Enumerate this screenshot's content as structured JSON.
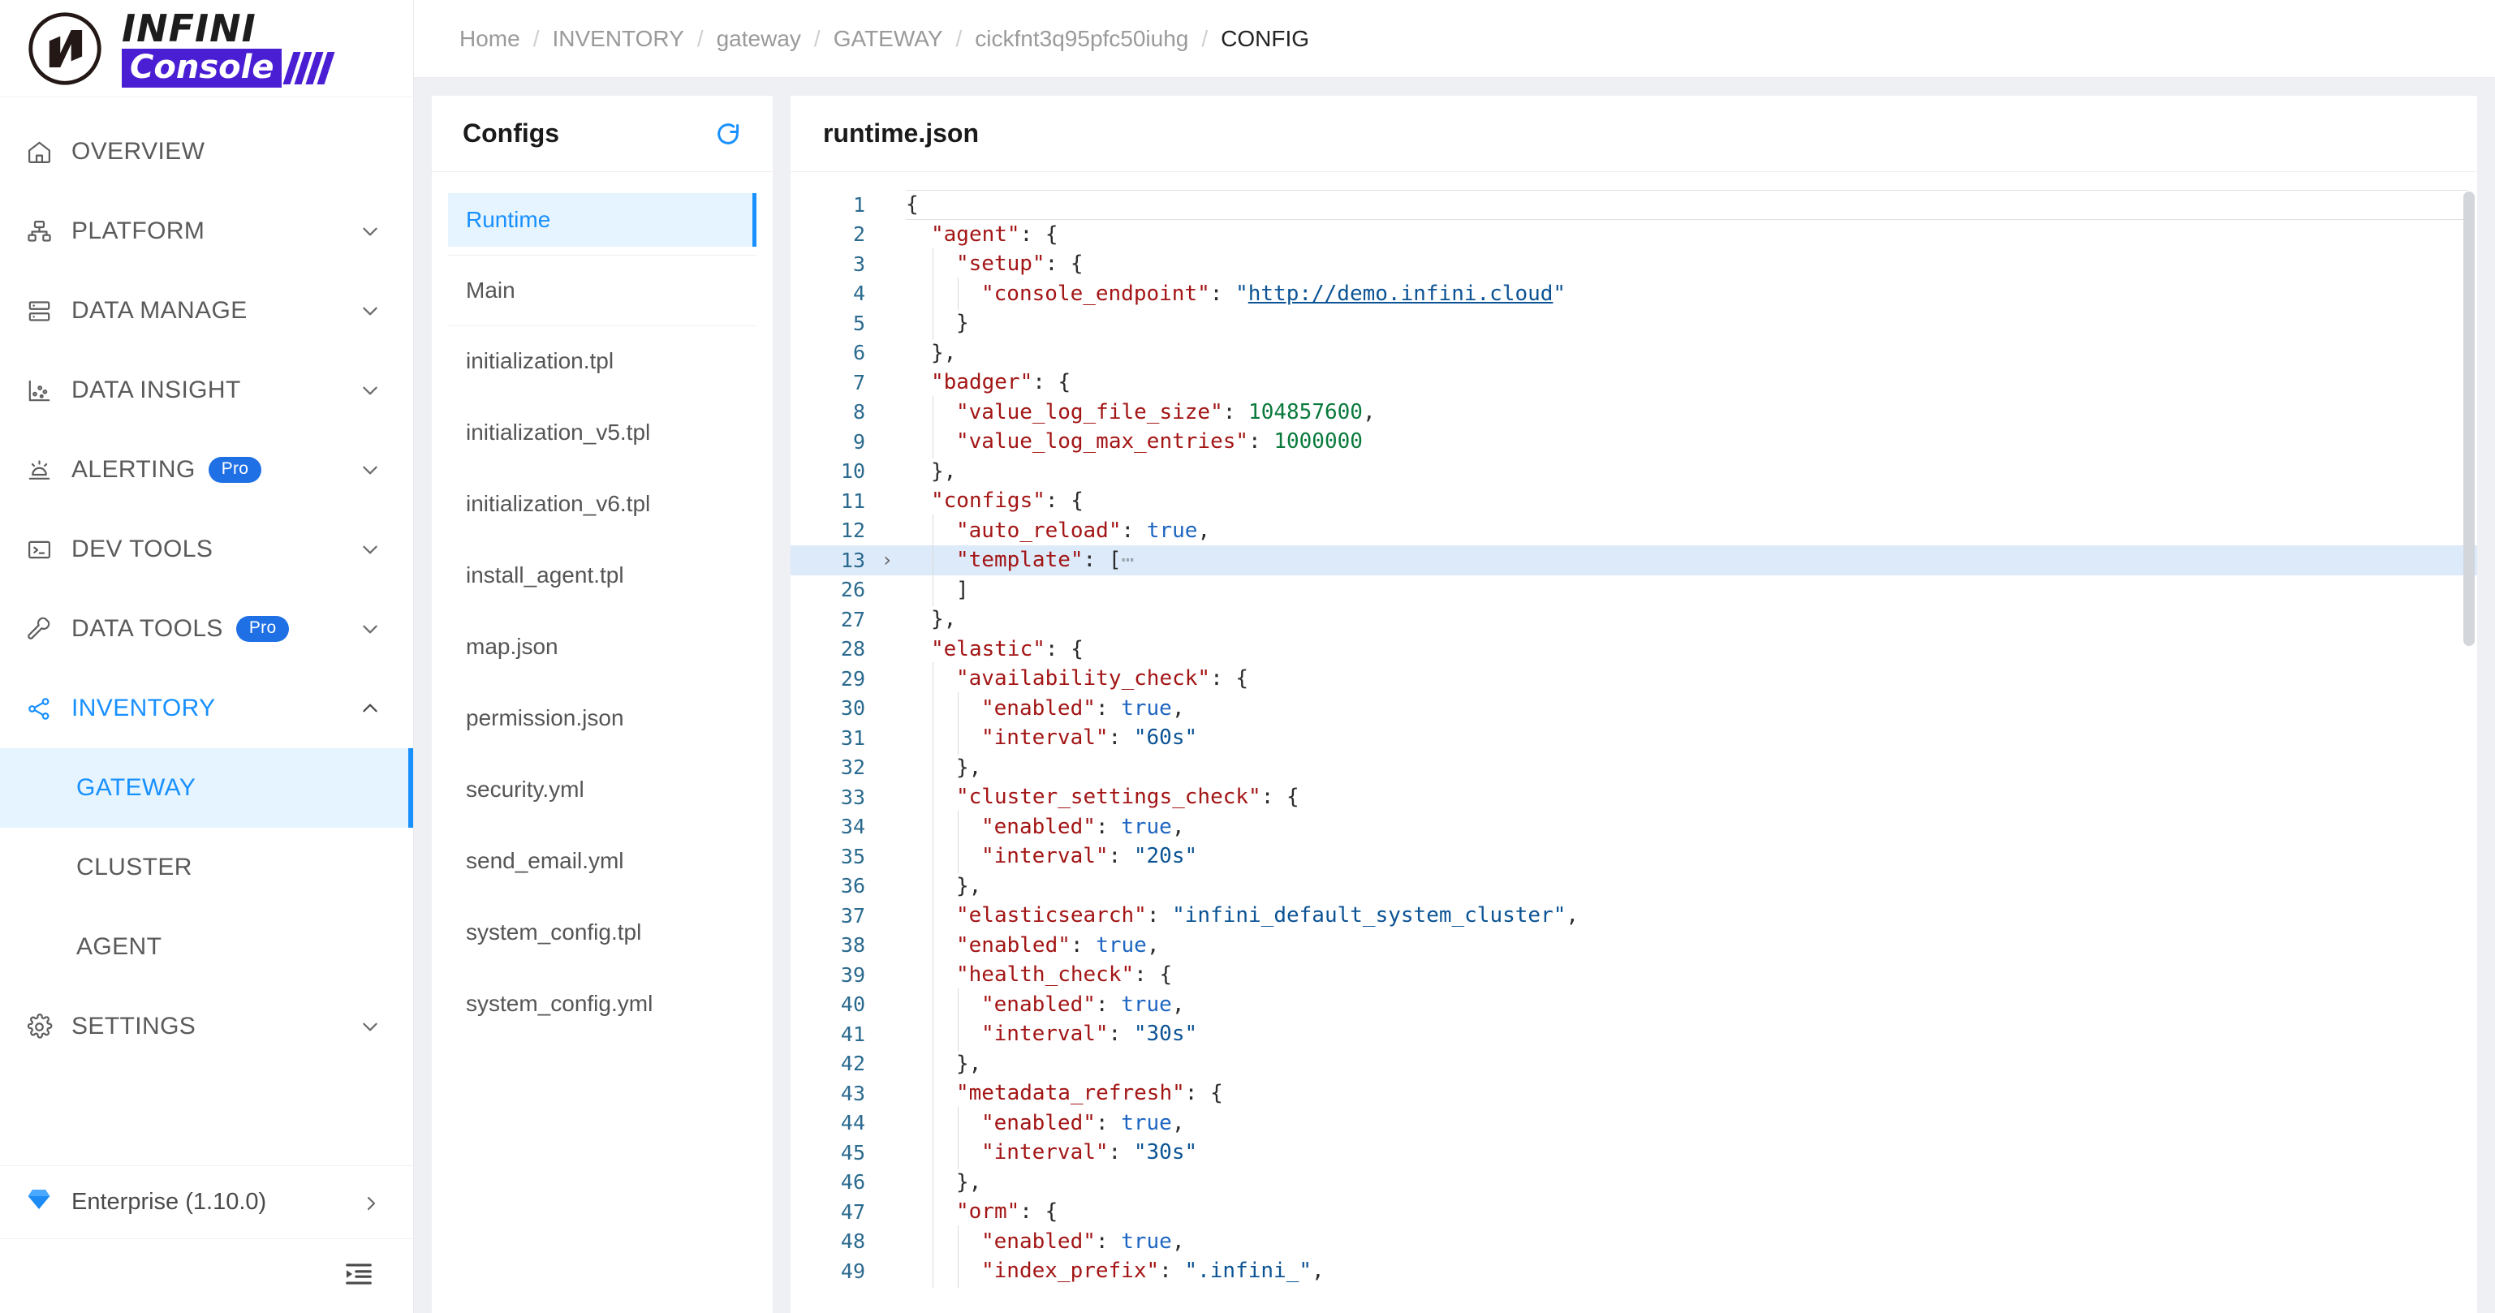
{
  "brand": {
    "name_top": "INFINI",
    "name_bottom": "Console",
    "accent_purple": "#4a1fd4"
  },
  "sidebar": {
    "items": [
      {
        "label": "OVERVIEW",
        "icon": "home-icon",
        "expandable": false,
        "badge": null,
        "active": false
      },
      {
        "label": "PLATFORM",
        "icon": "sitemap-icon",
        "expandable": true,
        "badge": null,
        "active": false
      },
      {
        "label": "DATA MANAGE",
        "icon": "database-icon",
        "expandable": true,
        "badge": null,
        "active": false
      },
      {
        "label": "DATA INSIGHT",
        "icon": "scatter-icon",
        "expandable": true,
        "badge": null,
        "active": false
      },
      {
        "label": "ALERTING",
        "icon": "alarm-icon",
        "expandable": true,
        "badge": "Pro",
        "active": false
      },
      {
        "label": "DEV TOOLS",
        "icon": "terminal-icon",
        "expandable": true,
        "badge": null,
        "active": false
      },
      {
        "label": "DATA TOOLS",
        "icon": "wrench-icon",
        "expandable": true,
        "badge": "Pro",
        "active": false
      },
      {
        "label": "INVENTORY",
        "icon": "share-icon",
        "expandable": true,
        "badge": null,
        "active": true
      }
    ],
    "inventory_children": [
      {
        "label": "GATEWAY",
        "selected": true
      },
      {
        "label": "CLUSTER",
        "selected": false
      },
      {
        "label": "AGENT",
        "selected": false
      }
    ],
    "settings": {
      "label": "SETTINGS",
      "icon": "gear-icon",
      "expandable": true
    },
    "footer": {
      "label": "Enterprise (1.10.0)",
      "icon": "diamond-icon"
    },
    "collapse": {
      "icon": "menu-fold-icon"
    },
    "accent_blue": "#1890ff",
    "badge_blue": "#1f6fe5"
  },
  "breadcrumb": {
    "separator": "/",
    "items": [
      {
        "label": "Home",
        "current": false
      },
      {
        "label": "INVENTORY",
        "current": false
      },
      {
        "label": "gateway",
        "current": false
      },
      {
        "label": "GATEWAY",
        "current": false
      },
      {
        "label": "cickfnt3q95pfc50iuhg",
        "current": false
      },
      {
        "label": "CONFIG",
        "current": true
      }
    ]
  },
  "configs_panel": {
    "title": "Configs",
    "refresh_icon": "refresh-icon",
    "groups": [
      {
        "items": [
          {
            "label": "Runtime",
            "selected": true
          }
        ]
      },
      {
        "items": [
          {
            "label": "Main",
            "selected": false
          }
        ]
      },
      {
        "items": [
          {
            "label": "initialization.tpl",
            "selected": false
          },
          {
            "label": "initialization_v5.tpl",
            "selected": false
          },
          {
            "label": "initialization_v6.tpl",
            "selected": false
          },
          {
            "label": "install_agent.tpl",
            "selected": false
          },
          {
            "label": "map.json",
            "selected": false
          },
          {
            "label": "permission.json",
            "selected": false
          },
          {
            "label": "security.yml",
            "selected": false
          },
          {
            "label": "send_email.yml",
            "selected": false
          },
          {
            "label": "system_config.tpl",
            "selected": false
          },
          {
            "label": "system_config.yml",
            "selected": false
          }
        ]
      }
    ]
  },
  "editor": {
    "filename": "runtime.json",
    "language": "json",
    "active_line": 13,
    "folded_line": 13,
    "lines": [
      {
        "no": "1",
        "indent": 0,
        "fold": "",
        "tokens": [
          {
            "t": "{",
            "c": "p"
          }
        ]
      },
      {
        "no": "2",
        "indent": 1,
        "fold": "",
        "tokens": [
          {
            "t": "\"agent\"",
            "c": "k"
          },
          {
            "t": ": {",
            "c": "p"
          }
        ]
      },
      {
        "no": "3",
        "indent": 2,
        "fold": "",
        "tokens": [
          {
            "t": "\"setup\"",
            "c": "k"
          },
          {
            "t": ": {",
            "c": "p"
          }
        ]
      },
      {
        "no": "4",
        "indent": 3,
        "fold": "",
        "tokens": [
          {
            "t": "\"console_endpoint\"",
            "c": "k"
          },
          {
            "t": ": ",
            "c": "p"
          },
          {
            "t": "\"",
            "c": "s"
          },
          {
            "t": "http://demo.infini.cloud",
            "c": "url"
          },
          {
            "t": "\"",
            "c": "s"
          }
        ]
      },
      {
        "no": "5",
        "indent": 2,
        "fold": "",
        "tokens": [
          {
            "t": "}",
            "c": "p"
          }
        ]
      },
      {
        "no": "6",
        "indent": 1,
        "fold": "",
        "tokens": [
          {
            "t": "},",
            "c": "p"
          }
        ]
      },
      {
        "no": "7",
        "indent": 1,
        "fold": "",
        "tokens": [
          {
            "t": "\"badger\"",
            "c": "k"
          },
          {
            "t": ": {",
            "c": "p"
          }
        ]
      },
      {
        "no": "8",
        "indent": 2,
        "fold": "",
        "tokens": [
          {
            "t": "\"value_log_file_size\"",
            "c": "k"
          },
          {
            "t": ": ",
            "c": "p"
          },
          {
            "t": "104857600",
            "c": "n"
          },
          {
            "t": ",",
            "c": "p"
          }
        ]
      },
      {
        "no": "9",
        "indent": 2,
        "fold": "",
        "tokens": [
          {
            "t": "\"value_log_max_entries\"",
            "c": "k"
          },
          {
            "t": ": ",
            "c": "p"
          },
          {
            "t": "1000000",
            "c": "n"
          }
        ]
      },
      {
        "no": "10",
        "indent": 1,
        "fold": "",
        "tokens": [
          {
            "t": "},",
            "c": "p"
          }
        ]
      },
      {
        "no": "11",
        "indent": 1,
        "fold": "",
        "tokens": [
          {
            "t": "\"configs\"",
            "c": "k"
          },
          {
            "t": ": {",
            "c": "p"
          }
        ]
      },
      {
        "no": "12",
        "indent": 2,
        "fold": "",
        "tokens": [
          {
            "t": "\"auto_reload\"",
            "c": "k"
          },
          {
            "t": ": ",
            "c": "p"
          },
          {
            "t": "true",
            "c": "b"
          },
          {
            "t": ",",
            "c": "p"
          }
        ]
      },
      {
        "no": "13",
        "indent": 2,
        "fold": "›",
        "active": true,
        "tokens": [
          {
            "t": "\"template\"",
            "c": "k"
          },
          {
            "t": ": [",
            "c": "p"
          },
          {
            "t": "⋯",
            "c": "ell"
          }
        ]
      },
      {
        "no": "26",
        "indent": 2,
        "fold": "",
        "tokens": [
          {
            "t": "]",
            "c": "p"
          }
        ]
      },
      {
        "no": "27",
        "indent": 1,
        "fold": "",
        "tokens": [
          {
            "t": "},",
            "c": "p"
          }
        ]
      },
      {
        "no": "28",
        "indent": 1,
        "fold": "",
        "tokens": [
          {
            "t": "\"elastic\"",
            "c": "k"
          },
          {
            "t": ": {",
            "c": "p"
          }
        ]
      },
      {
        "no": "29",
        "indent": 2,
        "fold": "",
        "tokens": [
          {
            "t": "\"availability_check\"",
            "c": "k"
          },
          {
            "t": ": {",
            "c": "p"
          }
        ]
      },
      {
        "no": "30",
        "indent": 3,
        "fold": "",
        "tokens": [
          {
            "t": "\"enabled\"",
            "c": "k"
          },
          {
            "t": ": ",
            "c": "p"
          },
          {
            "t": "true",
            "c": "b"
          },
          {
            "t": ",",
            "c": "p"
          }
        ]
      },
      {
        "no": "31",
        "indent": 3,
        "fold": "",
        "tokens": [
          {
            "t": "\"interval\"",
            "c": "k"
          },
          {
            "t": ": ",
            "c": "p"
          },
          {
            "t": "\"60s\"",
            "c": "s"
          }
        ]
      },
      {
        "no": "32",
        "indent": 2,
        "fold": "",
        "tokens": [
          {
            "t": "},",
            "c": "p"
          }
        ]
      },
      {
        "no": "33",
        "indent": 2,
        "fold": "",
        "tokens": [
          {
            "t": "\"cluster_settings_check\"",
            "c": "k"
          },
          {
            "t": ": {",
            "c": "p"
          }
        ]
      },
      {
        "no": "34",
        "indent": 3,
        "fold": "",
        "tokens": [
          {
            "t": "\"enabled\"",
            "c": "k"
          },
          {
            "t": ": ",
            "c": "p"
          },
          {
            "t": "true",
            "c": "b"
          },
          {
            "t": ",",
            "c": "p"
          }
        ]
      },
      {
        "no": "35",
        "indent": 3,
        "fold": "",
        "tokens": [
          {
            "t": "\"interval\"",
            "c": "k"
          },
          {
            "t": ": ",
            "c": "p"
          },
          {
            "t": "\"20s\"",
            "c": "s"
          }
        ]
      },
      {
        "no": "36",
        "indent": 2,
        "fold": "",
        "tokens": [
          {
            "t": "},",
            "c": "p"
          }
        ]
      },
      {
        "no": "37",
        "indent": 2,
        "fold": "",
        "tokens": [
          {
            "t": "\"elasticsearch\"",
            "c": "k"
          },
          {
            "t": ": ",
            "c": "p"
          },
          {
            "t": "\"infini_default_system_cluster\"",
            "c": "s"
          },
          {
            "t": ",",
            "c": "p"
          }
        ]
      },
      {
        "no": "38",
        "indent": 2,
        "fold": "",
        "tokens": [
          {
            "t": "\"enabled\"",
            "c": "k"
          },
          {
            "t": ": ",
            "c": "p"
          },
          {
            "t": "true",
            "c": "b"
          },
          {
            "t": ",",
            "c": "p"
          }
        ]
      },
      {
        "no": "39",
        "indent": 2,
        "fold": "",
        "tokens": [
          {
            "t": "\"health_check\"",
            "c": "k"
          },
          {
            "t": ": {",
            "c": "p"
          }
        ]
      },
      {
        "no": "40",
        "indent": 3,
        "fold": "",
        "tokens": [
          {
            "t": "\"enabled\"",
            "c": "k"
          },
          {
            "t": ": ",
            "c": "p"
          },
          {
            "t": "true",
            "c": "b"
          },
          {
            "t": ",",
            "c": "p"
          }
        ]
      },
      {
        "no": "41",
        "indent": 3,
        "fold": "",
        "tokens": [
          {
            "t": "\"interval\"",
            "c": "k"
          },
          {
            "t": ": ",
            "c": "p"
          },
          {
            "t": "\"30s\"",
            "c": "s"
          }
        ]
      },
      {
        "no": "42",
        "indent": 2,
        "fold": "",
        "tokens": [
          {
            "t": "},",
            "c": "p"
          }
        ]
      },
      {
        "no": "43",
        "indent": 2,
        "fold": "",
        "tokens": [
          {
            "t": "\"metadata_refresh\"",
            "c": "k"
          },
          {
            "t": ": {",
            "c": "p"
          }
        ]
      },
      {
        "no": "44",
        "indent": 3,
        "fold": "",
        "tokens": [
          {
            "t": "\"enabled\"",
            "c": "k"
          },
          {
            "t": ": ",
            "c": "p"
          },
          {
            "t": "true",
            "c": "b"
          },
          {
            "t": ",",
            "c": "p"
          }
        ]
      },
      {
        "no": "45",
        "indent": 3,
        "fold": "",
        "tokens": [
          {
            "t": "\"interval\"",
            "c": "k"
          },
          {
            "t": ": ",
            "c": "p"
          },
          {
            "t": "\"30s\"",
            "c": "s"
          }
        ]
      },
      {
        "no": "46",
        "indent": 2,
        "fold": "",
        "tokens": [
          {
            "t": "},",
            "c": "p"
          }
        ]
      },
      {
        "no": "47",
        "indent": 2,
        "fold": "",
        "tokens": [
          {
            "t": "\"orm\"",
            "c": "k"
          },
          {
            "t": ": {",
            "c": "p"
          }
        ]
      },
      {
        "no": "48",
        "indent": 3,
        "fold": "",
        "tokens": [
          {
            "t": "\"enabled\"",
            "c": "k"
          },
          {
            "t": ": ",
            "c": "p"
          },
          {
            "t": "true",
            "c": "b"
          },
          {
            "t": ",",
            "c": "p"
          }
        ]
      },
      {
        "no": "49",
        "indent": 3,
        "fold": "",
        "tokens": [
          {
            "t": "\"index_prefix\"",
            "c": "k"
          },
          {
            "t": ": ",
            "c": "p"
          },
          {
            "t": "\".infini_\"",
            "c": "s"
          },
          {
            "t": ",",
            "c": "p"
          }
        ]
      }
    ]
  }
}
